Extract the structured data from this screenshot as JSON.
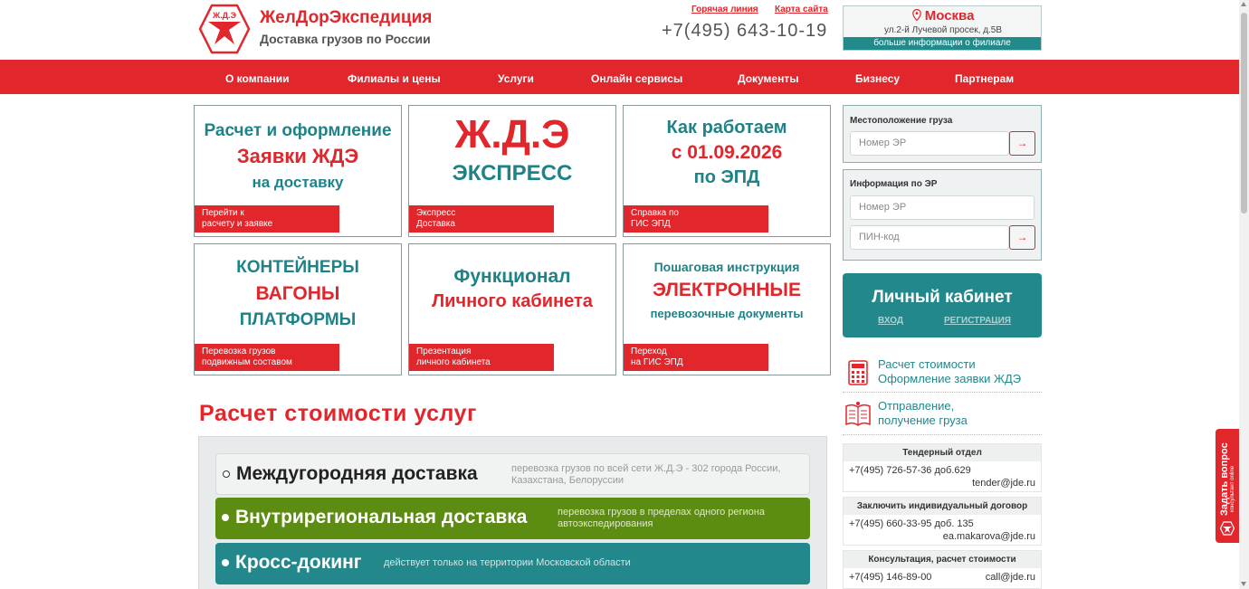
{
  "header": {
    "brand_name": "ЖелДорЭкспедиция",
    "brand_sub": "Доставка грузов по России",
    "logo_text": "Ж.Д.Э",
    "hotline_label": "Горячая линия",
    "sitemap_label": "Карта сайта",
    "phone": "+7(495) 643-10-19",
    "city": "Москва",
    "city_address": "ул.2-й Лучевой просек, д.5В",
    "city_more": "больше информации о филиале"
  },
  "nav": {
    "items": [
      {
        "label": "О компании"
      },
      {
        "label": "Филиалы и цены"
      },
      {
        "label": "Услуги"
      },
      {
        "label": "Онлайн сервисы"
      },
      {
        "label": "Документы"
      },
      {
        "label": "Бизнесу"
      },
      {
        "label": "Партнерам"
      }
    ]
  },
  "tiles": [
    {
      "l1": "Расчет и оформление",
      "l2": "Заявки ЖДЭ",
      "l3": "на доставку",
      "b1": "Перейти к",
      "b2": "расчету и заявке"
    },
    {
      "l1": "Ж.Д.Э",
      "l2": "ЭКСПРЕСС",
      "b1": "Экспресс",
      "b2": "Доставка"
    },
    {
      "l1": "Как работаем",
      "l2": "с 01.09.2026",
      "l3": "по ЭПД",
      "b1": "Справка по",
      "b2": "ГИС ЭПД"
    },
    {
      "l1": "контейнеры",
      "l2": "вагоны",
      "l3": "платформы",
      "b1": "Перевозка грузов",
      "b2": "подвижным составом"
    },
    {
      "l1": "Функционал",
      "l2": "Личного кабинета",
      "b1": "Презентация",
      "b2": "личного кабинета"
    },
    {
      "l1": "Пошаговая инструкция",
      "l2": "ЭЛЕКТРОННЫЕ",
      "l3": "перевозочные документы",
      "b1": "Переход",
      "b2": "на ГИС ЭПД"
    }
  ],
  "calc": {
    "title": "Расчет стоимости услуг",
    "options": [
      {
        "title": "Междугородняя доставка",
        "desc1": "перевозка грузов по всей сети Ж.Д.Э - 302 города России,",
        "desc2": "Казахстана, Белоруссии"
      },
      {
        "title": "Внутрирегиональная доставка",
        "desc1": "перевозка грузов в пределах одного региона",
        "desc2": "автоэкспедирования"
      },
      {
        "title": "Кросс-докинг",
        "desc1": "действует только на территории Московской области"
      }
    ]
  },
  "side": {
    "location_label": "Местоположение груза",
    "location_placeholder": "Номер ЭР",
    "info_label": "Информация по ЭР",
    "info_placeholder": "Номер ЭР",
    "pin_placeholder": "ПИН-код",
    "go_symbol": "→",
    "cabinet_title": "Личный кабинет",
    "cabinet_login": "вход",
    "cabinet_register": "регистрация",
    "quick1_l1": "Расчет стоимости",
    "quick1_l2": "Оформление заявки ЖДЭ",
    "quick2_l1": "Отправление,",
    "quick2_l2": "получение груза",
    "contacts": [
      {
        "head": "Тендерный отдел",
        "phone": "+7(495) 726-57-36 доб.629",
        "mail": "tender@jde.ru"
      },
      {
        "head": "Заключить индивидуальный договор",
        "phone": "+7(495) 660-33-95 доб. 135",
        "mail": "ea.makarova@jde.ru"
      },
      {
        "head": "Консультация, расчет стоимости",
        "phone": "+7(495) 146-89-00",
        "mail": "call@jde.ru"
      }
    ]
  },
  "ask": {
    "label": "Задать вопрос",
    "sub": "консультант online"
  },
  "colors": {
    "brand_red": "#e1262c",
    "teal": "#23888b",
    "green": "#5d8c12"
  }
}
